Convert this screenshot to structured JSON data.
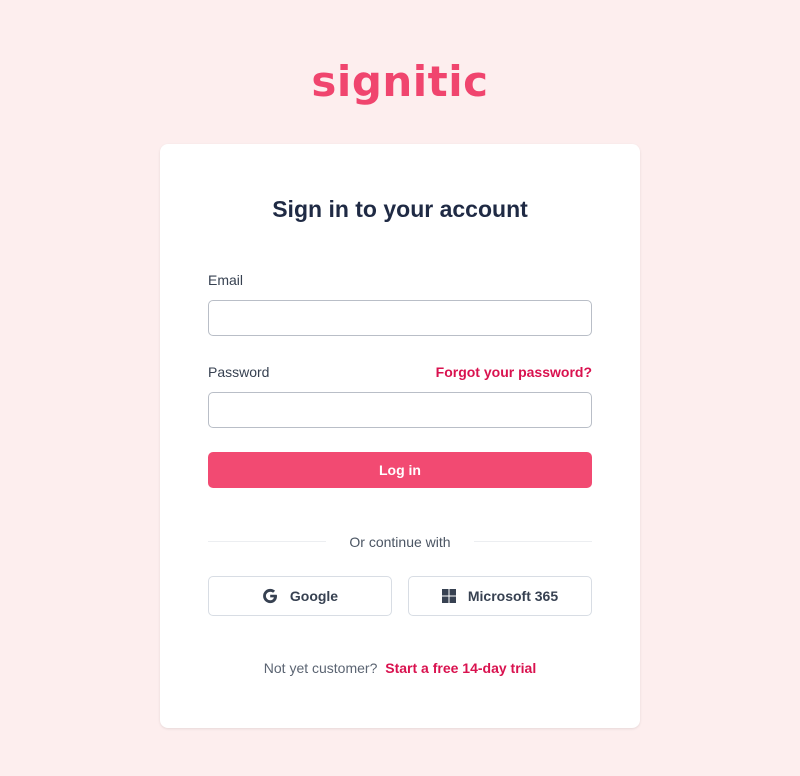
{
  "brand": {
    "logo_text": "signitic",
    "color": "#f0456e"
  },
  "form": {
    "title": "Sign in to your account",
    "email_label": "Email",
    "email_value": "",
    "password_label": "Password",
    "password_value": "",
    "forgot_link": "Forgot your password?",
    "login_button": "Log in"
  },
  "sso": {
    "divider_text": "Or continue with",
    "google_label": "Google",
    "google_icon": "google-g-icon",
    "microsoft_label": "Microsoft 365",
    "microsoft_icon": "windows-icon"
  },
  "footer": {
    "prompt": "Not yet customer?",
    "trial_link": "Start a free 14-day trial"
  },
  "colors": {
    "background": "#fdeeee",
    "accent": "#f24a72",
    "link": "#d9124f"
  }
}
